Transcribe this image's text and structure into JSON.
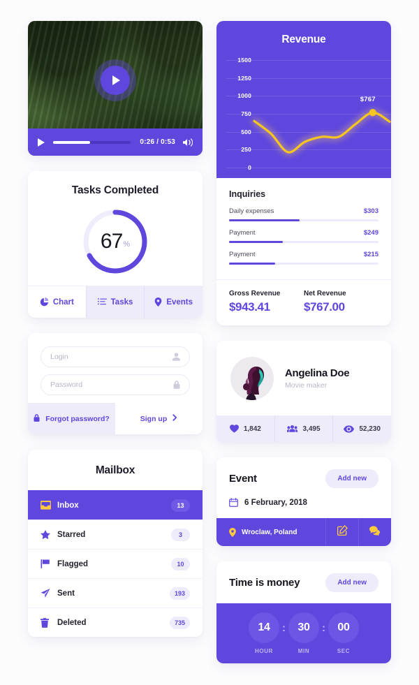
{
  "colors": {
    "primary": "#5f47de",
    "accent_yellow": "#ffc93c",
    "lavender": "#eeebfb",
    "page_bg": "#fcfcfd"
  },
  "video": {
    "play_icon": "play-icon",
    "time": "0:26 / 0:53",
    "progress_percent": 48,
    "volume_icon": "volume-icon"
  },
  "tasks": {
    "title": "Tasks Completed",
    "value": "67",
    "percent_symbol": "%",
    "progress": 67,
    "tabs": [
      {
        "label": "Chart",
        "icon": "pie-chart-icon",
        "active": true
      },
      {
        "label": "Tasks",
        "icon": "list-icon",
        "active": false
      },
      {
        "label": "Events",
        "icon": "map-pin-icon",
        "active": false
      }
    ]
  },
  "revenue": {
    "title": "Revenue",
    "tooltip": "$767",
    "inquiries_title": "Inquiries",
    "inquiries": [
      {
        "name": "Daily expenses",
        "value": "$303",
        "percent": 47
      },
      {
        "name": "Payment",
        "value": "$249",
        "percent": 36
      },
      {
        "name": "Payment",
        "value": "$215",
        "percent": 31
      }
    ],
    "totals": [
      {
        "label": "Gross Revenue",
        "amount": "$943.41"
      },
      {
        "label": "Net Revenue",
        "amount": "$767.00"
      }
    ]
  },
  "chart_data": {
    "type": "line",
    "title": "Revenue",
    "xlabel": "",
    "ylabel": "",
    "ylim": [
      0,
      1500
    ],
    "yticks": [
      1500,
      1250,
      1000,
      750,
      500,
      250,
      0
    ],
    "grid": true,
    "legend": "none",
    "line_color": "#ffc93c",
    "x": [
      0,
      1,
      2,
      3,
      4,
      5,
      6,
      7,
      8
    ],
    "values": [
      650,
      470,
      215,
      360,
      430,
      430,
      610,
      767,
      640
    ],
    "annotations": [
      {
        "label": "$767",
        "x": 7,
        "y": 767,
        "marker": true
      }
    ]
  },
  "login": {
    "username_placeholder": "Login",
    "username_value": "",
    "username_icon": "user-icon",
    "password_placeholder": "Password",
    "password_value": "",
    "password_icon": "lock-icon",
    "forgot_label": "Forgot password?",
    "forgot_icon": "lock-icon",
    "signup_label": "Sign up",
    "signup_icon": "chevron-right-icon"
  },
  "profile": {
    "name": "Angelina Doe",
    "role": "Movie maker",
    "avatar": "user-avatar",
    "stats": [
      {
        "icon": "heart-icon",
        "value": "1,842"
      },
      {
        "icon": "users-icon",
        "value": "3,495"
      },
      {
        "icon": "eye-icon",
        "value": "52,230"
      }
    ]
  },
  "mailbox": {
    "title": "Mailbox",
    "items": [
      {
        "label": "Inbox",
        "count": "13",
        "icon": "inbox-icon",
        "active": true
      },
      {
        "label": "Starred",
        "count": "3",
        "icon": "star-icon",
        "active": false
      },
      {
        "label": "Flagged",
        "count": "10",
        "icon": "flag-icon",
        "active": false
      },
      {
        "label": "Sent",
        "count": "193",
        "icon": "send-icon",
        "active": false
      },
      {
        "label": "Deleted",
        "count": "735",
        "icon": "trash-icon",
        "active": false
      }
    ]
  },
  "event": {
    "title": "Event",
    "add_label": "Add new",
    "date": "6 February, 2018",
    "date_icon": "calendar-icon",
    "location": "Wroclaw, Poland",
    "location_icon": "map-pin-icon",
    "edit_icon": "edit-icon",
    "chat_icon": "chat-icon"
  },
  "timer": {
    "title": "Time is money",
    "add_label": "Add new",
    "separator": ":",
    "units": [
      {
        "value": "14",
        "label": "HOUR"
      },
      {
        "value": "30",
        "label": "MIN"
      },
      {
        "value": "00",
        "label": "SEC"
      }
    ]
  }
}
